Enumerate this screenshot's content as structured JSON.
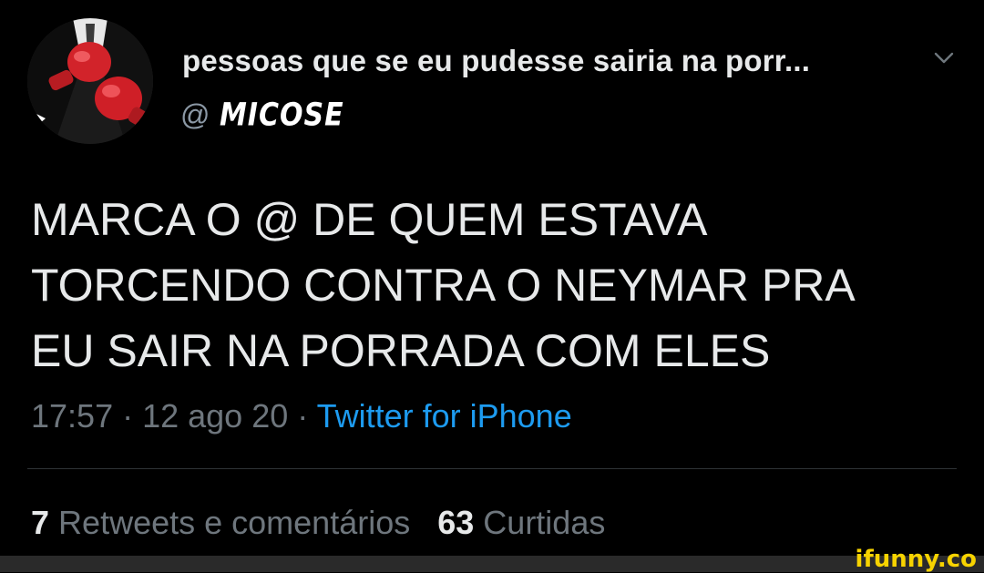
{
  "tweet": {
    "display_name": "pessoas que se eu pudesse sairia na porr...",
    "handle_prefix": "@",
    "handle_logo_text": "MICOSE",
    "text": "MARCA O @ DE QUEM ESTAVA\nTORCENDO CONTRA O NEYMAR PRA\nEU SAIR NA PORRADA COM ELES",
    "time": "17:57",
    "date": "12 ago 20",
    "separator": " · ",
    "source": "Twitter for iPhone",
    "retweets_count": "7",
    "retweets_label": "Retweets e comentários",
    "likes_count": "63",
    "likes_label": "Curtidas",
    "avatar_icon": "boxing-gloves-icon",
    "more_icon": "chevron-down-icon"
  },
  "watermark": {
    "text": "ifunny.co"
  },
  "colors": {
    "background": "#000000",
    "text_primary": "#e7e9ea",
    "text_secondary": "#6e767d",
    "link": "#1d9bf0",
    "glove_red": "#d2232a",
    "watermark": "#f7d300"
  }
}
